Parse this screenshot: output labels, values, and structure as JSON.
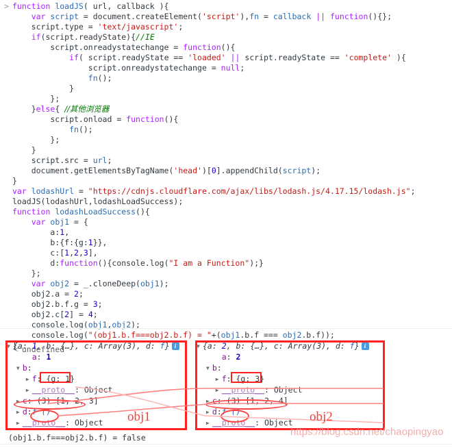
{
  "console": {
    "prompt_symbol": ">",
    "return_symbol": "<",
    "return_value": "undefined",
    "code_lines": [
      [
        {
          "t": "kw",
          "s": "function "
        },
        {
          "t": "id",
          "s": "loadJS"
        },
        {
          "t": "plain",
          "s": "( url, callback ){"
        }
      ],
      [
        {
          "t": "plain",
          "s": "    "
        },
        {
          "t": "kw",
          "s": "var "
        },
        {
          "t": "id",
          "s": "script"
        },
        {
          "t": "plain",
          "s": " = document.createElement("
        },
        {
          "t": "str",
          "s": "'script'"
        },
        {
          "t": "plain",
          "s": "),"
        },
        {
          "t": "id",
          "s": "fn"
        },
        {
          "t": "plain",
          "s": " = "
        },
        {
          "t": "id",
          "s": "callback"
        },
        {
          "t": "plain",
          "s": " "
        },
        {
          "t": "op",
          "s": "||"
        },
        {
          "t": "plain",
          "s": " "
        },
        {
          "t": "kw",
          "s": "function"
        },
        {
          "t": "plain",
          "s": "(){};"
        }
      ],
      [
        {
          "t": "plain",
          "s": "    script.type = "
        },
        {
          "t": "str",
          "s": "'text/javascript'"
        },
        {
          "t": "plain",
          "s": ";"
        }
      ],
      [
        {
          "t": "plain",
          "s": "    "
        },
        {
          "t": "kw",
          "s": "if"
        },
        {
          "t": "plain",
          "s": "(script.readyState){"
        },
        {
          "t": "cmt",
          "s": "//IE"
        }
      ],
      [
        {
          "t": "plain",
          "s": "        script.onreadystatechange = "
        },
        {
          "t": "kw",
          "s": "function"
        },
        {
          "t": "plain",
          "s": "(){"
        }
      ],
      [
        {
          "t": "plain",
          "s": "            "
        },
        {
          "t": "kw",
          "s": "if"
        },
        {
          "t": "plain",
          "s": "( script.readyState == "
        },
        {
          "t": "str",
          "s": "'loaded'"
        },
        {
          "t": "plain",
          "s": " "
        },
        {
          "t": "op",
          "s": "||"
        },
        {
          "t": "plain",
          "s": " script.readyState == "
        },
        {
          "t": "str",
          "s": "'complete'"
        },
        {
          "t": "plain",
          "s": " ){"
        }
      ],
      [
        {
          "t": "plain",
          "s": "                script.onreadystatechange = "
        },
        {
          "t": "kw",
          "s": "null"
        },
        {
          "t": "plain",
          "s": ";"
        }
      ],
      [
        {
          "t": "plain",
          "s": "                "
        },
        {
          "t": "id",
          "s": "fn"
        },
        {
          "t": "plain",
          "s": "();"
        }
      ],
      [
        {
          "t": "plain",
          "s": "            }"
        }
      ],
      [
        {
          "t": "plain",
          "s": "        };"
        }
      ],
      [
        {
          "t": "plain",
          "s": "    }"
        },
        {
          "t": "kw",
          "s": "else"
        },
        {
          "t": "plain",
          "s": "{ "
        },
        {
          "t": "cmt-cn",
          "s": "//其他浏览器"
        }
      ],
      [
        {
          "t": "plain",
          "s": "        script.onload = "
        },
        {
          "t": "kw",
          "s": "function"
        },
        {
          "t": "plain",
          "s": "(){"
        }
      ],
      [
        {
          "t": "plain",
          "s": "            "
        },
        {
          "t": "id",
          "s": "fn"
        },
        {
          "t": "plain",
          "s": "();"
        }
      ],
      [
        {
          "t": "plain",
          "s": "        };"
        }
      ],
      [
        {
          "t": "plain",
          "s": "    }"
        }
      ],
      [
        {
          "t": "plain",
          "s": "    script.src = "
        },
        {
          "t": "id",
          "s": "url"
        },
        {
          "t": "plain",
          "s": ";"
        }
      ],
      [
        {
          "t": "plain",
          "s": "    document.getElementsByTagName("
        },
        {
          "t": "str",
          "s": "'head'"
        },
        {
          "t": "plain",
          "s": ")["
        },
        {
          "t": "num",
          "s": "0"
        },
        {
          "t": "plain",
          "s": "].appendChild("
        },
        {
          "t": "id",
          "s": "script"
        },
        {
          "t": "plain",
          "s": ");"
        }
      ],
      [
        {
          "t": "plain",
          "s": "}"
        }
      ],
      [
        {
          "t": "kw",
          "s": "var "
        },
        {
          "t": "id",
          "s": "lodashUrl"
        },
        {
          "t": "plain",
          "s": " = "
        },
        {
          "t": "str",
          "s": "\"https://cdnjs.cloudflare.com/ajax/libs/lodash.js/4.17.15/lodash.js\""
        },
        {
          "t": "plain",
          "s": ";"
        }
      ],
      [
        {
          "t": "plain",
          "s": "loadJS(lodashUrl,lodashLoadSuccess);"
        }
      ],
      [
        {
          "t": "kw",
          "s": "function "
        },
        {
          "t": "id",
          "s": "lodashLoadSuccess"
        },
        {
          "t": "plain",
          "s": "(){"
        }
      ],
      [
        {
          "t": "plain",
          "s": "    "
        },
        {
          "t": "kw",
          "s": "var "
        },
        {
          "t": "id",
          "s": "obj1"
        },
        {
          "t": "plain",
          "s": " = {"
        }
      ],
      [
        {
          "t": "plain",
          "s": "        a:"
        },
        {
          "t": "num",
          "s": "1"
        },
        {
          "t": "plain",
          "s": ","
        }
      ],
      [
        {
          "t": "plain",
          "s": "        b:{f:{g:"
        },
        {
          "t": "num",
          "s": "1"
        },
        {
          "t": "plain",
          "s": "}},"
        }
      ],
      [
        {
          "t": "plain",
          "s": "        c:["
        },
        {
          "t": "num",
          "s": "1"
        },
        {
          "t": "plain",
          "s": ","
        },
        {
          "t": "num",
          "s": "2"
        },
        {
          "t": "plain",
          "s": ","
        },
        {
          "t": "num",
          "s": "3"
        },
        {
          "t": "plain",
          "s": "],"
        }
      ],
      [
        {
          "t": "plain",
          "s": "        d:"
        },
        {
          "t": "kw",
          "s": "function"
        },
        {
          "t": "plain",
          "s": "(){console.log("
        },
        {
          "t": "str",
          "s": "\"I am a Function\""
        },
        {
          "t": "plain",
          "s": ");}"
        }
      ],
      [
        {
          "t": "plain",
          "s": "    };"
        }
      ],
      [
        {
          "t": "plain",
          "s": "    "
        },
        {
          "t": "kw",
          "s": "var "
        },
        {
          "t": "id",
          "s": "obj2"
        },
        {
          "t": "plain",
          "s": " = _.cloneDeep("
        },
        {
          "t": "id",
          "s": "obj1"
        },
        {
          "t": "plain",
          "s": ");"
        }
      ],
      [
        {
          "t": "plain",
          "s": "    obj2.a = "
        },
        {
          "t": "num",
          "s": "2"
        },
        {
          "t": "plain",
          "s": ";"
        }
      ],
      [
        {
          "t": "plain",
          "s": "    obj2.b.f.g = "
        },
        {
          "t": "num",
          "s": "3"
        },
        {
          "t": "plain",
          "s": ";"
        }
      ],
      [
        {
          "t": "plain",
          "s": "    obj2.c["
        },
        {
          "t": "num",
          "s": "2"
        },
        {
          "t": "plain",
          "s": "] = "
        },
        {
          "t": "num",
          "s": "4"
        },
        {
          "t": "plain",
          "s": ";"
        }
      ],
      [
        {
          "t": "plain",
          "s": "    console.log("
        },
        {
          "t": "id",
          "s": "obj1"
        },
        {
          "t": "plain",
          "s": ","
        },
        {
          "t": "id",
          "s": "obj2"
        },
        {
          "t": "plain",
          "s": ");"
        }
      ],
      [
        {
          "t": "plain",
          "s": "    console.log("
        },
        {
          "t": "str",
          "s": "\"(obj1.b.f===obj2.b.f) = \""
        },
        {
          "t": "plain",
          "s": "+("
        },
        {
          "t": "id",
          "s": "obj1"
        },
        {
          "t": "plain",
          "s": ".b.f === "
        },
        {
          "t": "id",
          "s": "obj2"
        },
        {
          "t": "plain",
          "s": ".b.f));"
        }
      ],
      [
        {
          "t": "plain",
          "s": "}"
        }
      ]
    ]
  },
  "objects": [
    {
      "name": "obj1",
      "header": "{a: 1, b: {…}, c: Array(3), d: f}",
      "header_parts": [
        {
          "t": "plain",
          "s": "{a: "
        },
        {
          "t": "num",
          "s": "1"
        },
        {
          "t": "plain",
          "s": ", b: {…}, c: Array(3), d: "
        },
        {
          "t": "fn",
          "s": "f"
        },
        {
          "t": "plain",
          "s": "}"
        }
      ],
      "info_badge": "i",
      "rows": [
        {
          "indent": 2,
          "tri": "",
          "key": "a",
          "sep": ": ",
          "val": "1",
          "valtype": "num"
        },
        {
          "indent": 1,
          "tri": "▼",
          "key": "b",
          "sep": ":",
          "val": "",
          "valtype": "none"
        },
        {
          "indent": 2,
          "tri": "▶",
          "key": "f",
          "sep": ": ",
          "val": "{g: 1}",
          "valtype": "objlit"
        },
        {
          "indent": 2,
          "tri": "▶",
          "key": "__proto__",
          "sep": ": ",
          "val": "Object",
          "valtype": "plain"
        },
        {
          "indent": 1,
          "tri": "▶",
          "key": "c",
          "sep": ": ",
          "val": "(3) [1, 2, 3]",
          "valtype": "array"
        },
        {
          "indent": 1,
          "tri": "▶",
          "key": "d",
          "sep": ":",
          "val": "f ()",
          "valtype": "fn"
        },
        {
          "indent": 1,
          "tri": "▶",
          "key": "__proto__",
          "sep": ": ",
          "val": "Object",
          "valtype": "plain"
        }
      ]
    },
    {
      "name": "obj2",
      "header": "{a: 2, b: {…}, c: Array(3), d: f}",
      "header_parts": [
        {
          "t": "plain",
          "s": "{a: "
        },
        {
          "t": "num",
          "s": "2"
        },
        {
          "t": "plain",
          "s": ", b: {…}, c: Array(3), d: "
        },
        {
          "t": "fn",
          "s": "f"
        },
        {
          "t": "plain",
          "s": "}"
        }
      ],
      "info_badge": "i",
      "rows": [
        {
          "indent": 2,
          "tri": "",
          "key": "a",
          "sep": ": ",
          "val": "2",
          "valtype": "num"
        },
        {
          "indent": 1,
          "tri": "▼",
          "key": "b",
          "sep": ":",
          "val": "",
          "valtype": "none"
        },
        {
          "indent": 2,
          "tri": "▶",
          "key": "f",
          "sep": ": ",
          "val": "{g: 3}",
          "valtype": "objlit"
        },
        {
          "indent": 2,
          "tri": "▶",
          "key": "__proto__",
          "sep": ": ",
          "val": "Object",
          "valtype": "plain"
        },
        {
          "indent": 1,
          "tri": "▶",
          "key": "c",
          "sep": ": ",
          "val": "(3) [1, 2, 4]",
          "valtype": "array"
        },
        {
          "indent": 1,
          "tri": "▶",
          "key": "d",
          "sep": ":",
          "val": "f ()",
          "valtype": "fn"
        },
        {
          "indent": 1,
          "tri": "▶",
          "key": "__proto__",
          "sep": ": ",
          "val": "Object",
          "valtype": "plain"
        }
      ]
    }
  ],
  "annotations": {
    "label_obj1": "obj1",
    "label_obj2": "obj2",
    "highlight_g1": "{g: 1}",
    "highlight_g2": "{g: 3}",
    "accent_color": "#ff2020"
  },
  "bottom_log": "(obj1.b.f===obj2.b.f) = false",
  "watermark": "https://blog.csdn.net/chaopingyao"
}
